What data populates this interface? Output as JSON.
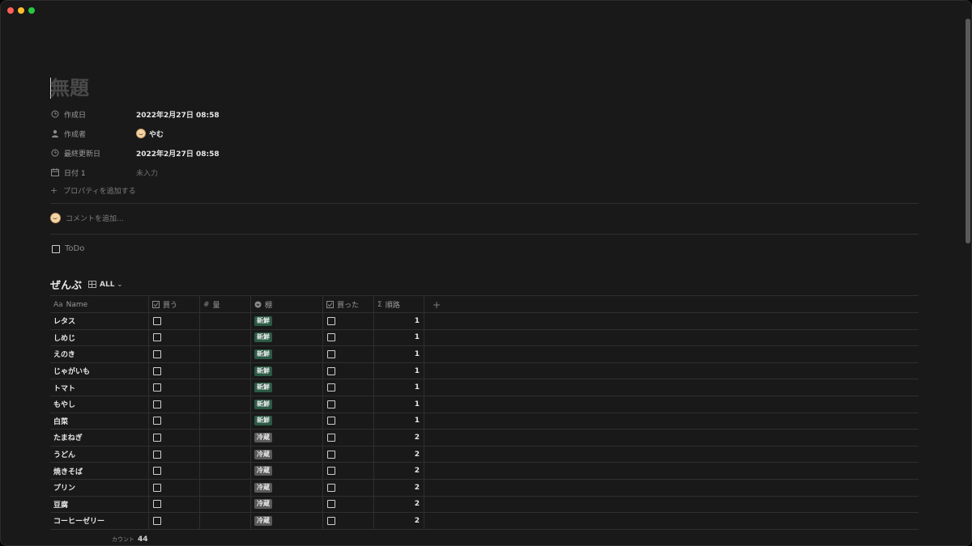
{
  "page": {
    "title": "無題"
  },
  "properties": [
    {
      "label": "作成日",
      "value": "2022年2月27日 08:58",
      "icon": "clock-icon"
    },
    {
      "label": "作成者",
      "value": "やむ",
      "icon": "person-icon"
    },
    {
      "label": "最終更新日",
      "value": "2022年2月27日 08:58",
      "icon": "clock-icon"
    },
    {
      "label": "日付 1",
      "value": "未入力",
      "icon": "calendar-icon"
    }
  ],
  "add_property_label": "プロパティを追加する",
  "comment_placeholder": "コメントを追加...",
  "todo_label": "ToDo",
  "database": {
    "title": "ぜんぶ",
    "view_label": "ALL",
    "columns": [
      {
        "label": "Name",
        "icon": "Aa"
      },
      {
        "label": "買う",
        "icon": "checkbox-icon"
      },
      {
        "label": "量",
        "icon": "#"
      },
      {
        "label": "棚",
        "icon": "select-icon"
      },
      {
        "label": "買った",
        "icon": "checkbox-icon"
      },
      {
        "label": "順路",
        "icon": "Σ"
      }
    ],
    "rows": [
      {
        "name": "レタス",
        "shelf": "新鮮",
        "route": "1"
      },
      {
        "name": "しめじ",
        "shelf": "新鮮",
        "route": "1"
      },
      {
        "name": "えのき",
        "shelf": "新鮮",
        "route": "1"
      },
      {
        "name": "じゃがいも",
        "shelf": "新鮮",
        "route": "1"
      },
      {
        "name": "トマト",
        "shelf": "新鮮",
        "route": "1"
      },
      {
        "name": "もやし",
        "shelf": "新鮮",
        "route": "1"
      },
      {
        "name": "白菜",
        "shelf": "新鮮",
        "route": "1"
      },
      {
        "name": "たまねぎ",
        "shelf": "冷蔵",
        "route": "2"
      },
      {
        "name": "うどん",
        "shelf": "冷蔵",
        "route": "2"
      },
      {
        "name": "焼きそば",
        "shelf": "冷蔵",
        "route": "2"
      },
      {
        "name": "プリン",
        "shelf": "冷蔵",
        "route": "2"
      },
      {
        "name": "豆腐",
        "shelf": "冷蔵",
        "route": "2"
      },
      {
        "name": "コーヒーゼリー",
        "shelf": "冷蔵",
        "route": "2"
      }
    ],
    "count_label": "カウント",
    "count_value": "44"
  },
  "colors": {
    "background": "#191919",
    "tag_fresh": "#2b5a45",
    "tag_fridge": "#5a5a5a"
  }
}
